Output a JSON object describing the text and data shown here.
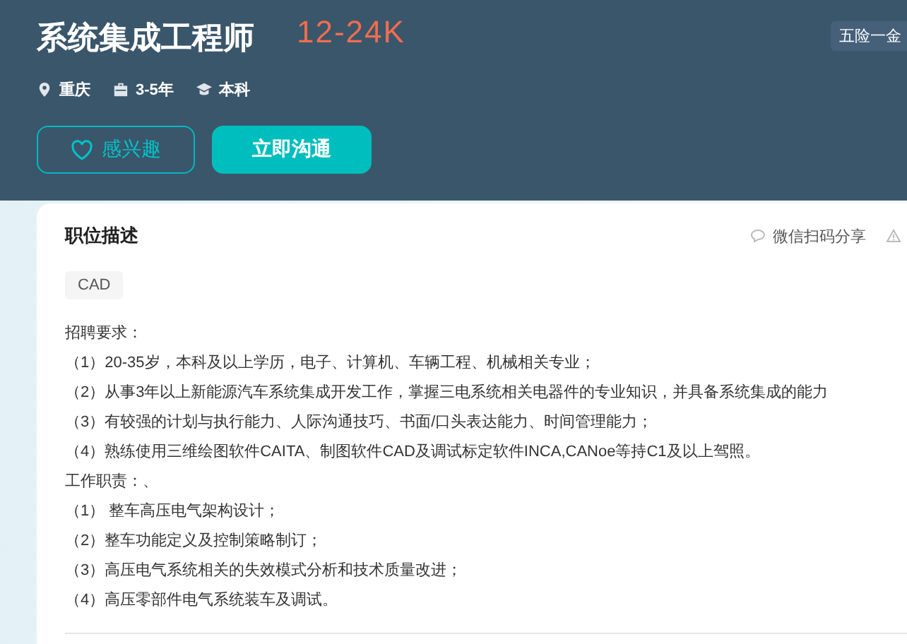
{
  "job": {
    "title": "系统集成工程师",
    "salary": "12-24K",
    "benefit_tag": "五险一金",
    "meta": [
      {
        "kind": "location",
        "text": "重庆"
      },
      {
        "kind": "experience",
        "text": "3-5年"
      },
      {
        "kind": "degree",
        "text": "本科"
      }
    ]
  },
  "buttons": [
    {
      "kind": "outline",
      "label": "感兴趣"
    },
    {
      "kind": "primary",
      "label": "立即沟通"
    }
  ],
  "description": {
    "heading": "职位描述",
    "share": "微信扫码分享",
    "tags": [
      "CAD"
    ],
    "lines": [
      "招聘要求：",
      "（1）20-35岁，本科及以上学历，电子、计算机、车辆工程、机械相关专业；",
      "（2）从事3年以上新能源汽车系统集成开发工作，掌握三电系统相关电器件的专业知识，并具备系统集成的能力",
      "（3）有较强的计划与执行能力、人际沟通技巧、书面/口头表达能力、时间管理能力；",
      "（4）熟练使用三维绘图软件CAITA、制图软件CAD及调试标定软件INCA,CANoe等持C1及以上驾照。",
      "工作职责：、",
      "（1） 整车高压电气架构设计；",
      "（2）整车功能定义及控制策略制订；",
      "（3）高压电气系统相关的失效模式分析和技术质量改进；",
      "（4）高压零部件电气系统装车及调试。"
    ]
  }
}
